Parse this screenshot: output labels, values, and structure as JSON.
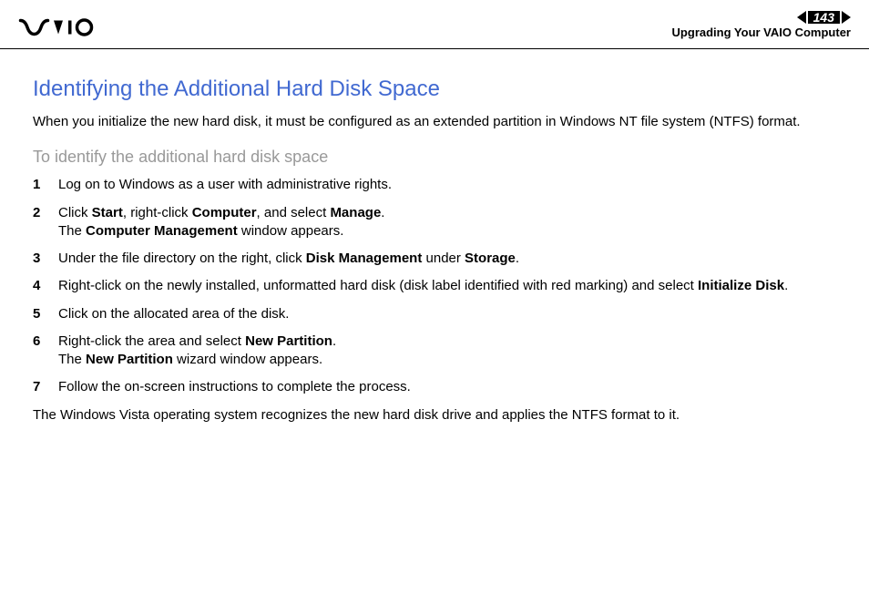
{
  "header": {
    "page_number": "143",
    "section_title": "Upgrading Your VAIO Computer"
  },
  "content": {
    "main_heading": "Identifying the Additional Hard Disk Space",
    "intro_text": "When you initialize the new hard disk, it must be configured as an extended partition in Windows NT file system (NTFS) format.",
    "sub_heading": "To identify the additional hard disk space",
    "steps": [
      {
        "number": "1",
        "text_parts": [
          {
            "text": "Log on to Windows as a user with administrative rights.",
            "bold": false
          }
        ]
      },
      {
        "number": "2",
        "text_parts": [
          {
            "text": "Click ",
            "bold": false
          },
          {
            "text": "Start",
            "bold": true
          },
          {
            "text": ", right-click ",
            "bold": false
          },
          {
            "text": "Computer",
            "bold": true
          },
          {
            "text": ", and select ",
            "bold": false
          },
          {
            "text": "Manage",
            "bold": true
          },
          {
            "text": ".",
            "bold": false
          },
          {
            "text": "\n",
            "bold": false
          },
          {
            "text": "The ",
            "bold": false
          },
          {
            "text": "Computer Management",
            "bold": true
          },
          {
            "text": " window appears.",
            "bold": false
          }
        ]
      },
      {
        "number": "3",
        "text_parts": [
          {
            "text": "Under the file directory on the right, click ",
            "bold": false
          },
          {
            "text": "Disk Management",
            "bold": true
          },
          {
            "text": " under ",
            "bold": false
          },
          {
            "text": "Storage",
            "bold": true
          },
          {
            "text": ".",
            "bold": false
          }
        ]
      },
      {
        "number": "4",
        "text_parts": [
          {
            "text": "Right-click on the newly installed, unformatted hard disk (disk label identified with red marking) and select ",
            "bold": false
          },
          {
            "text": "Initialize Disk",
            "bold": true
          },
          {
            "text": ".",
            "bold": false
          }
        ]
      },
      {
        "number": "5",
        "text_parts": [
          {
            "text": "Click on the allocated area of the disk.",
            "bold": false
          }
        ]
      },
      {
        "number": "6",
        "text_parts": [
          {
            "text": "Right-click the area and select ",
            "bold": false
          },
          {
            "text": "New Partition",
            "bold": true
          },
          {
            "text": ".",
            "bold": false
          },
          {
            "text": "\n",
            "bold": false
          },
          {
            "text": "The ",
            "bold": false
          },
          {
            "text": "New Partition",
            "bold": true
          },
          {
            "text": " wizard window appears.",
            "bold": false
          }
        ]
      },
      {
        "number": "7",
        "text_parts": [
          {
            "text": "Follow the on-screen instructions to complete the process.",
            "bold": false
          }
        ]
      }
    ],
    "closing_text": "The Windows Vista operating system recognizes the new hard disk drive and applies the NTFS format to it."
  }
}
